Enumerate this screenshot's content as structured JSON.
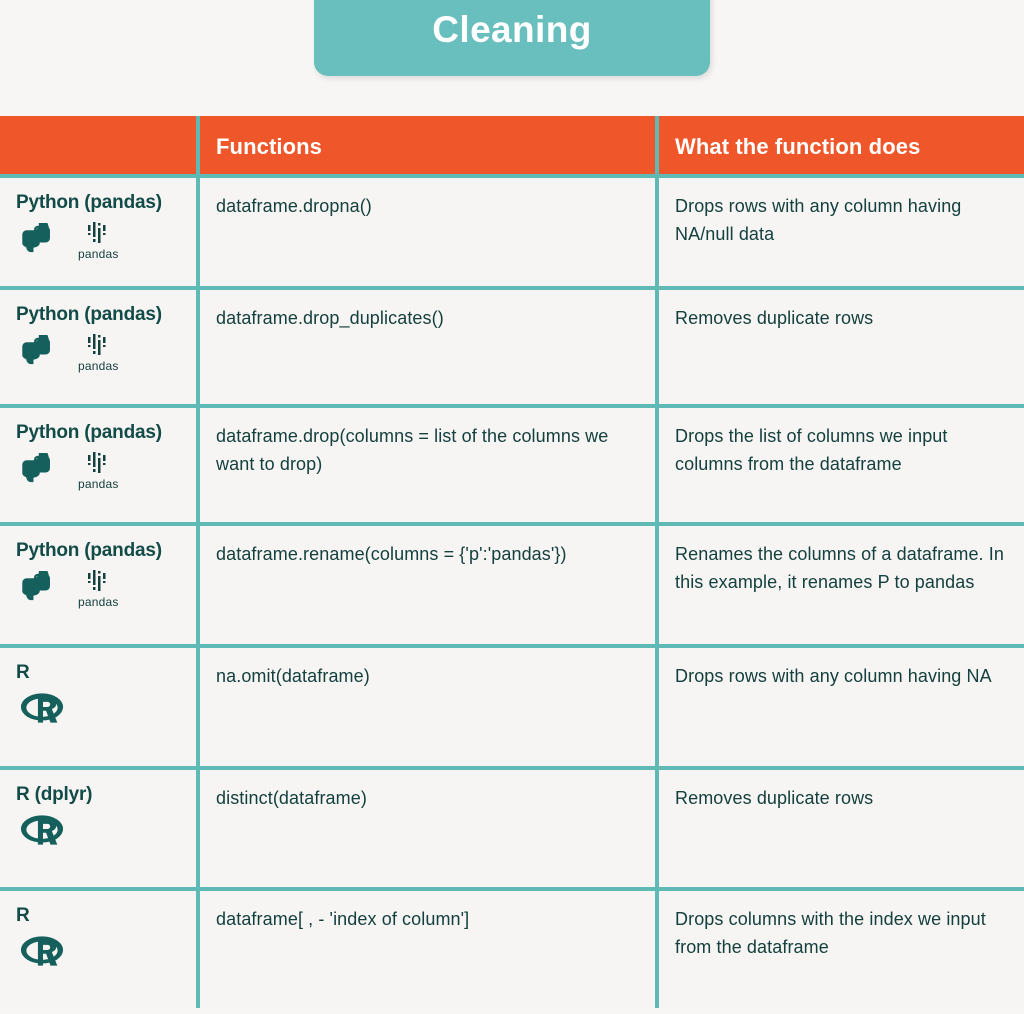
{
  "title": "Cleaning",
  "colors": {
    "title_bar": "#68bfbd",
    "header_row": "#ef562a",
    "border": "#5fb9b5",
    "text_dark": "#14403d",
    "page_background": "#f7f6f4",
    "cell_background": "#f6f5f3"
  },
  "table": {
    "headers": {
      "col1": "",
      "col2": "Functions",
      "col3": "What the function does"
    },
    "rows": [
      {
        "language": "Python (pandas)",
        "logos": [
          "python-logo",
          "pandas-logo"
        ],
        "pandas_wordmark": "pandas",
        "function": "dataframe.dropna()",
        "description": "Drops rows with any column having NA/null data"
      },
      {
        "language": "Python (pandas)",
        "logos": [
          "python-logo",
          "pandas-logo"
        ],
        "pandas_wordmark": "pandas",
        "function": "dataframe.drop_duplicates()",
        "description": "Removes duplicate rows"
      },
      {
        "language": "Python (pandas)",
        "logos": [
          "python-logo",
          "pandas-logo"
        ],
        "pandas_wordmark": "pandas",
        "function": "dataframe.drop(columns = list of the columns we want to drop)",
        "description": "Drops the list of columns we input columns from the dataframe"
      },
      {
        "language": "Python (pandas)",
        "logos": [
          "python-logo",
          "pandas-logo"
        ],
        "pandas_wordmark": "pandas",
        "function": "dataframe.rename(columns = {'p':'pandas'})",
        "description": "Renames the columns of a dataframe. In this example, it renames P to pandas"
      },
      {
        "language": "R",
        "logos": [
          "r-logo"
        ],
        "pandas_wordmark": "",
        "function": "na.omit(dataframe)",
        "description": "Drops rows with any column having NA"
      },
      {
        "language": "R (dplyr)",
        "logos": [
          "r-logo"
        ],
        "pandas_wordmark": "",
        "function": "distinct(dataframe)",
        "description": "Removes duplicate rows"
      },
      {
        "language": "R",
        "logos": [
          "r-logo"
        ],
        "pandas_wordmark": "",
        "function": "dataframe[ , - 'index of column']",
        "description": "Drops columns with the index we input from the dataframe"
      }
    ]
  }
}
